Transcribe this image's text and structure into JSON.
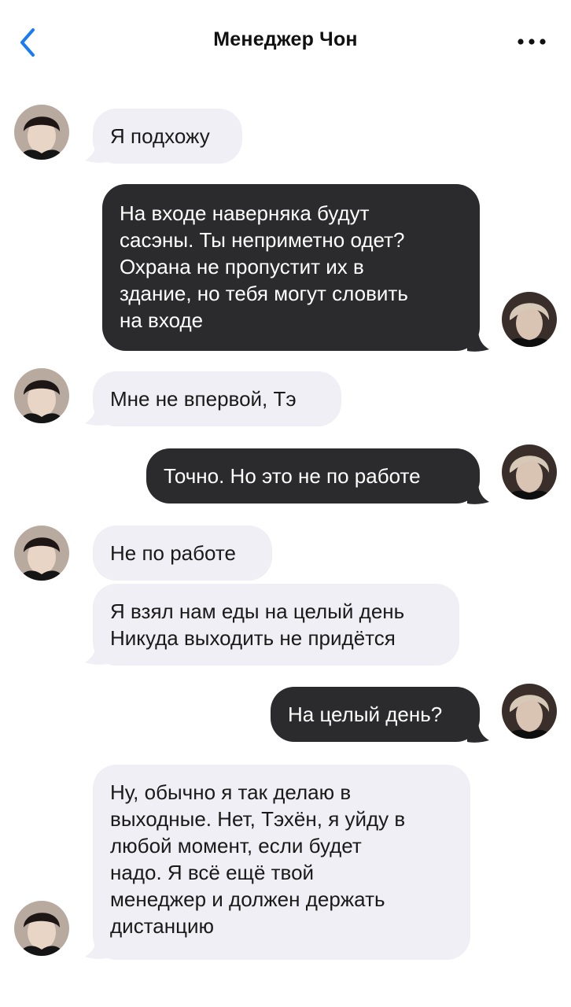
{
  "header": {
    "title": "Менеджер Чон",
    "back_icon": "chevron-left-icon",
    "more_icon": "more-horizontal-icon",
    "accent": "#1a7cf5"
  },
  "colors": {
    "incoming_bubble": "#efeff5",
    "outgoing_bubble": "#2b2b2e"
  },
  "messages": [
    {
      "sender": "contact",
      "text": "Я подхожу"
    },
    {
      "sender": "me",
      "text": "На входе наверняка будут\nсасэны. Ты неприметно одет?\nОхрана не пропустит их в\nздание, но тебя могут словить\nна входе"
    },
    {
      "sender": "contact",
      "text": "Мне не впервой, Тэ"
    },
    {
      "sender": "me",
      "text": "Точно. Но это не по работе"
    },
    {
      "sender": "contact",
      "text": "Не по работе"
    },
    {
      "sender": "contact",
      "text": "Я взял нам еды на целый день\nНикуда выходить не придётся"
    },
    {
      "sender": "me",
      "text": "На целый день?"
    },
    {
      "sender": "contact",
      "text": "Ну, обычно я так делаю в\nвыходные. Нет, Тэхён, я уйду в\nлюбой момент, если будет\nнадо. Я всё ещё твой\nменеджер и должен держать\nдистанцию"
    }
  ]
}
